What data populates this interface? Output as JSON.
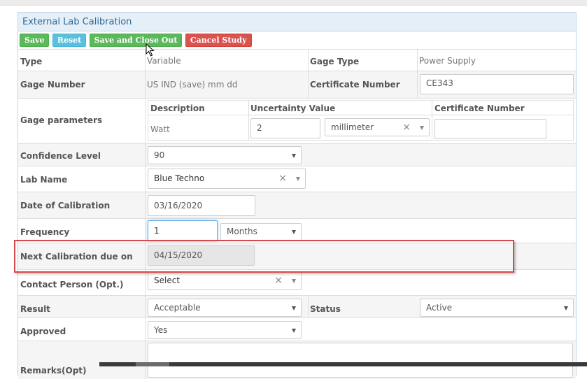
{
  "panel": {
    "title": "External Lab Calibration"
  },
  "toolbar": {
    "save_label": "Save",
    "reset_label": "Reset",
    "save_close_label": "Save and Close Out",
    "cancel_label": "Cancel Study"
  },
  "form": {
    "type_label": "Type",
    "type_value": "Variable",
    "gage_type_label": "Gage Type",
    "gage_type_value": "Power Supply",
    "gage_number_label": "Gage Number",
    "gage_number_value": "US IND (save) mm dd",
    "certificate_number_label": "Certificate Number",
    "certificate_number_value": "CE343",
    "gage_parameters_label": "Gage parameters",
    "params_headers": {
      "description": "Description",
      "uncertainty": "Uncertainty Value",
      "certificate": "Certificate Number"
    },
    "params_row": {
      "description": "Watt",
      "uncertainty_value": "2",
      "uncertainty_unit": "millimeter",
      "certificate": ""
    },
    "confidence_level_label": "Confidence Level",
    "confidence_level_value": "90",
    "lab_name_label": "Lab Name",
    "lab_name_value": "Blue Techno",
    "date_of_calibration_label": "Date of Calibration",
    "date_of_calibration_value": "03/16/2020",
    "frequency_label": "Frequency",
    "frequency_value": "1",
    "frequency_unit": "Months",
    "next_calibration_label": "Next Calibration due on",
    "next_calibration_value": "04/15/2020",
    "contact_person_label": "Contact Person (Opt.)",
    "contact_person_value": "Select",
    "result_label": "Result",
    "result_value": "Acceptable",
    "status_label": "Status",
    "status_value": "Active",
    "approved_label": "Approved",
    "approved_value": "Yes",
    "remarks_label": "Remarks(Opt)",
    "remarks_value": ""
  },
  "icons": {
    "clear": "×",
    "cursor": "mouse-pointer-icon"
  },
  "colors": {
    "save": "#5cb85c",
    "reset": "#5bc0de",
    "cancel": "#d9534f",
    "heading": "#2e6896",
    "highlight": "#d9484a"
  }
}
